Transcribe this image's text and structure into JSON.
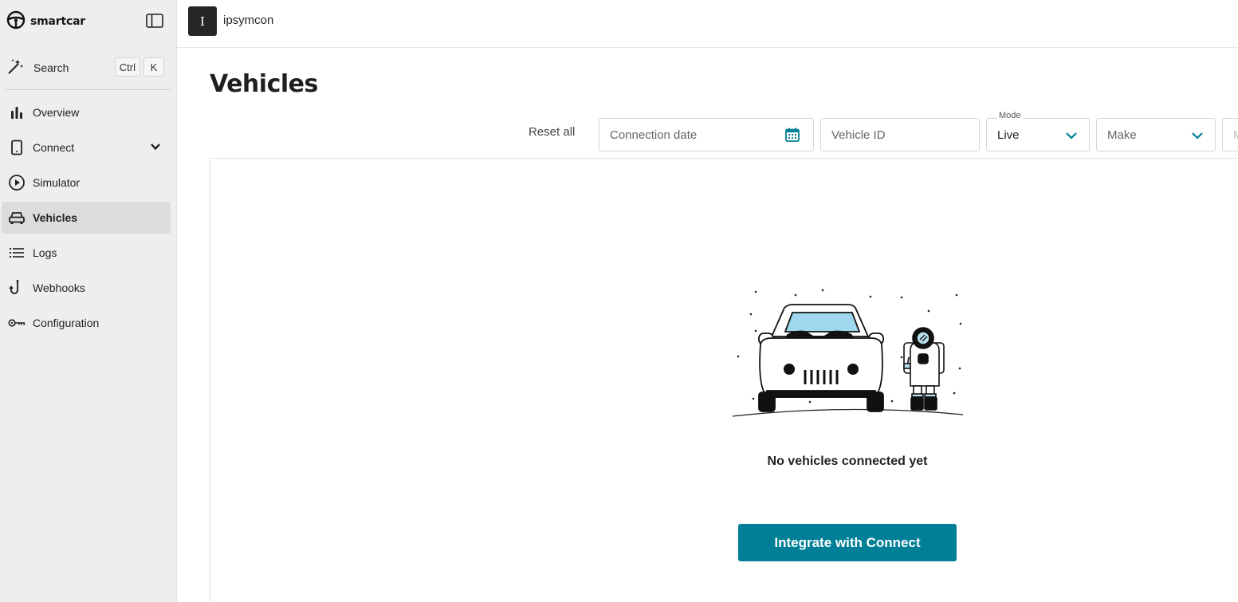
{
  "brand": {
    "name": "smartcar",
    "logo_icon": "steering-wheel-icon"
  },
  "sidebar": {
    "collapse_icon": "sidebar-toggle-icon",
    "search": {
      "label": "Search",
      "shortcut": [
        "Ctrl",
        "K"
      ],
      "icon": "magic-wand-icon"
    },
    "items": [
      {
        "label": "Overview",
        "icon": "bar-chart-icon",
        "active": false
      },
      {
        "label": "Connect",
        "icon": "tablet-icon",
        "active": false,
        "expandable": true
      },
      {
        "label": "Simulator",
        "icon": "play-circle-icon",
        "active": false
      },
      {
        "label": "Vehicles",
        "icon": "car-icon",
        "active": true
      },
      {
        "label": "Logs",
        "icon": "list-icon",
        "active": false
      },
      {
        "label": "Webhooks",
        "icon": "hook-icon",
        "active": false
      },
      {
        "label": "Configuration",
        "icon": "key-icon",
        "active": false
      }
    ]
  },
  "topbar": {
    "workspace_initial": "I",
    "workspace_name": "ipsymcon"
  },
  "main": {
    "title": "Vehicles",
    "filters": {
      "reset_label": "Reset all",
      "connection_date_placeholder": "Connection date",
      "vehicle_id_placeholder": "Vehicle ID",
      "mode_label": "Mode",
      "mode_value": "Live",
      "make_placeholder": "Make",
      "next_placeholder": "M"
    },
    "empty_state": {
      "message": "No vehicles connected yet",
      "cta_label": "Integrate with Connect"
    }
  },
  "colors": {
    "accent": "#007f96",
    "sidebar_bg": "#eeeeee",
    "active_item_bg": "#dcdcdc"
  }
}
